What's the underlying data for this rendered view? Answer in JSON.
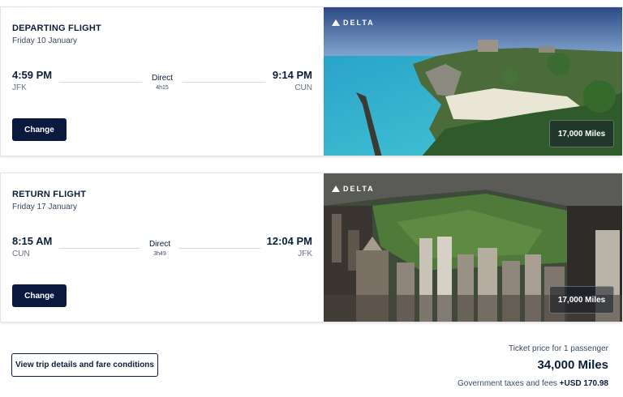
{
  "flights": [
    {
      "title": "DEPARTING FLIGHT",
      "date": "Friday 10 January",
      "depart_time": "4:59 PM",
      "depart_code": "JFK",
      "stops": "Direct",
      "duration": "4h15",
      "arrive_time": "9:14 PM",
      "arrive_code": "CUN",
      "change_label": "Change",
      "brand": "DELTA",
      "miles": "17,000 Miles",
      "image": "tulum-beach-cliff"
    },
    {
      "title": "RETURN FLIGHT",
      "date": "Friday 17 January",
      "depart_time": "8:15 AM",
      "depart_code": "CUN",
      "stops": "Direct",
      "duration": "3h49",
      "arrive_time": "12:04 PM",
      "arrive_code": "JFK",
      "change_label": "Change",
      "brand": "DELTA",
      "miles": "17,000 Miles",
      "image": "new-york-central-park"
    }
  ],
  "footer": {
    "details_label": "View trip details and fare conditions",
    "price_label": "Ticket price for 1 passenger",
    "price_total": "34,000 Miles",
    "taxes_label": "Government taxes and fees",
    "taxes_value": "+USD 170.98"
  },
  "colors": {
    "navy": "#0a1a3f",
    "text": "#0b1f3a",
    "muted": "#6a7384"
  }
}
